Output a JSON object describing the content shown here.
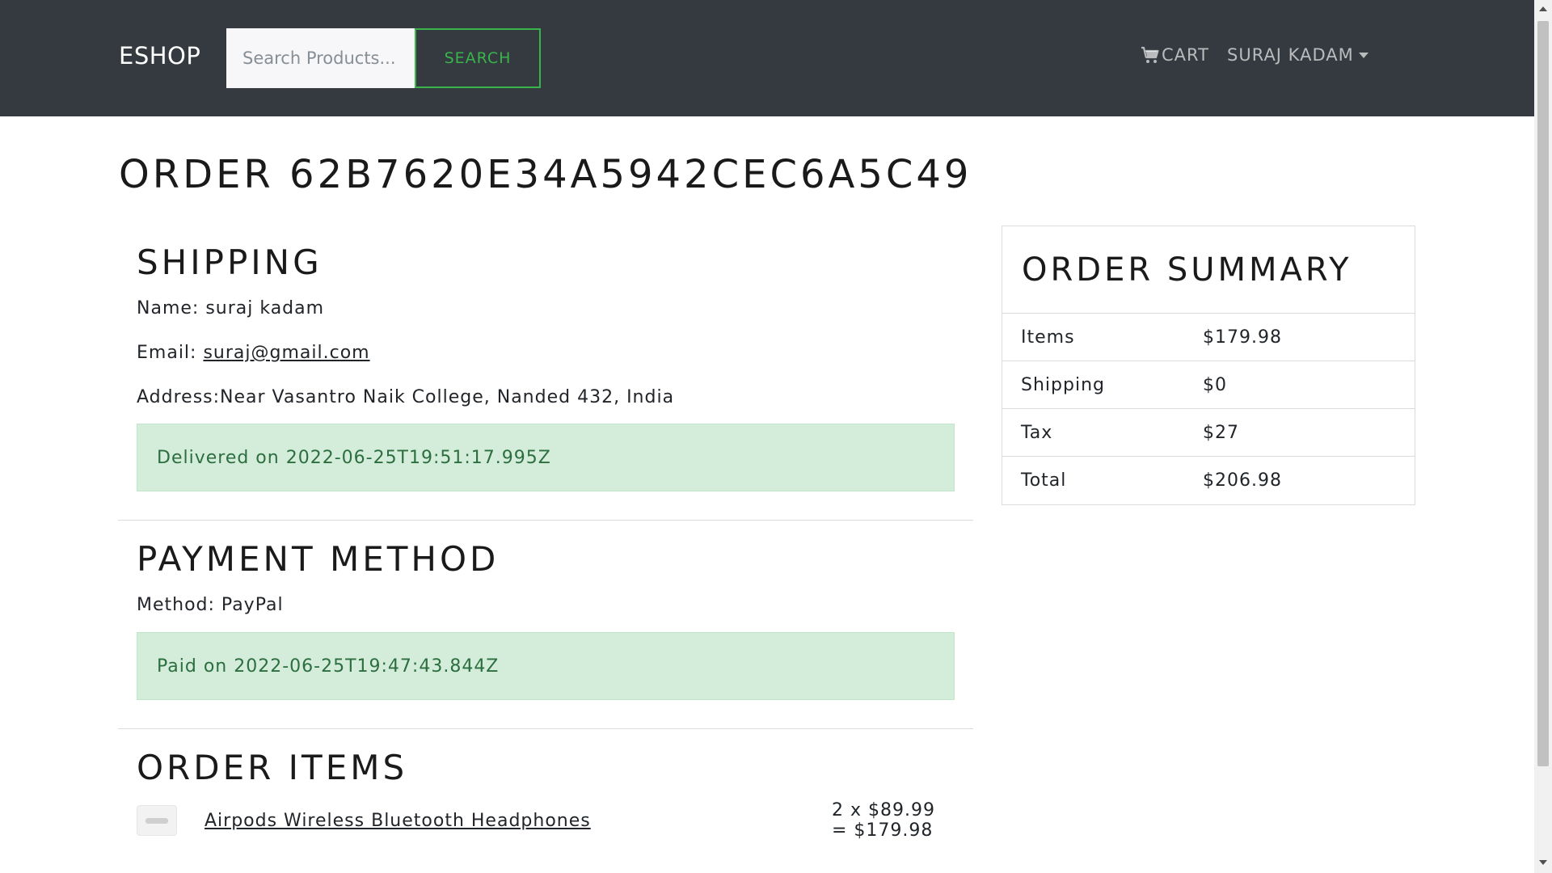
{
  "navbar": {
    "brand": "ESHOP",
    "search_placeholder": "Search Products...",
    "search_button": "SEARCH",
    "cart_label": "CART",
    "user_label": "SURAJ KADAM"
  },
  "order": {
    "title": "ORDER 62B7620E34A5942CEC6A5C49"
  },
  "shipping": {
    "heading": "SHIPPING",
    "name_prefix": "Name: ",
    "name": "suraj kadam",
    "email_prefix": "Email: ",
    "email": "suraj@gmail.com",
    "address_prefix": "Address:",
    "address": "Near Vasantro Naik College, Nanded 432, India",
    "status": "Delivered on 2022-06-25T19:51:17.995Z"
  },
  "payment": {
    "heading": "PAYMENT METHOD",
    "method_prefix": "Method: ",
    "method": "PayPal",
    "status": "Paid on 2022-06-25T19:47:43.844Z"
  },
  "order_items": {
    "heading": "ORDER ITEMS",
    "items": [
      {
        "name": "Airpods Wireless Bluetooth Headphones",
        "calc": "2 x $89.99 = $179.98"
      }
    ]
  },
  "summary": {
    "title": "ORDER SUMMARY",
    "rows": [
      {
        "label": "Items",
        "value": "$179.98"
      },
      {
        "label": "Shipping",
        "value": "$0"
      },
      {
        "label": "Tax",
        "value": "$27"
      },
      {
        "label": "Total",
        "value": "$206.98"
      }
    ]
  },
  "colors": {
    "navbar_bg": "#343a40",
    "accent_green": "#38b44a",
    "alert_bg": "#d4edda",
    "alert_text": "#2c6e3f"
  },
  "icons": {
    "cart": "shopping-cart-icon",
    "dropdown": "caret-down-icon"
  }
}
